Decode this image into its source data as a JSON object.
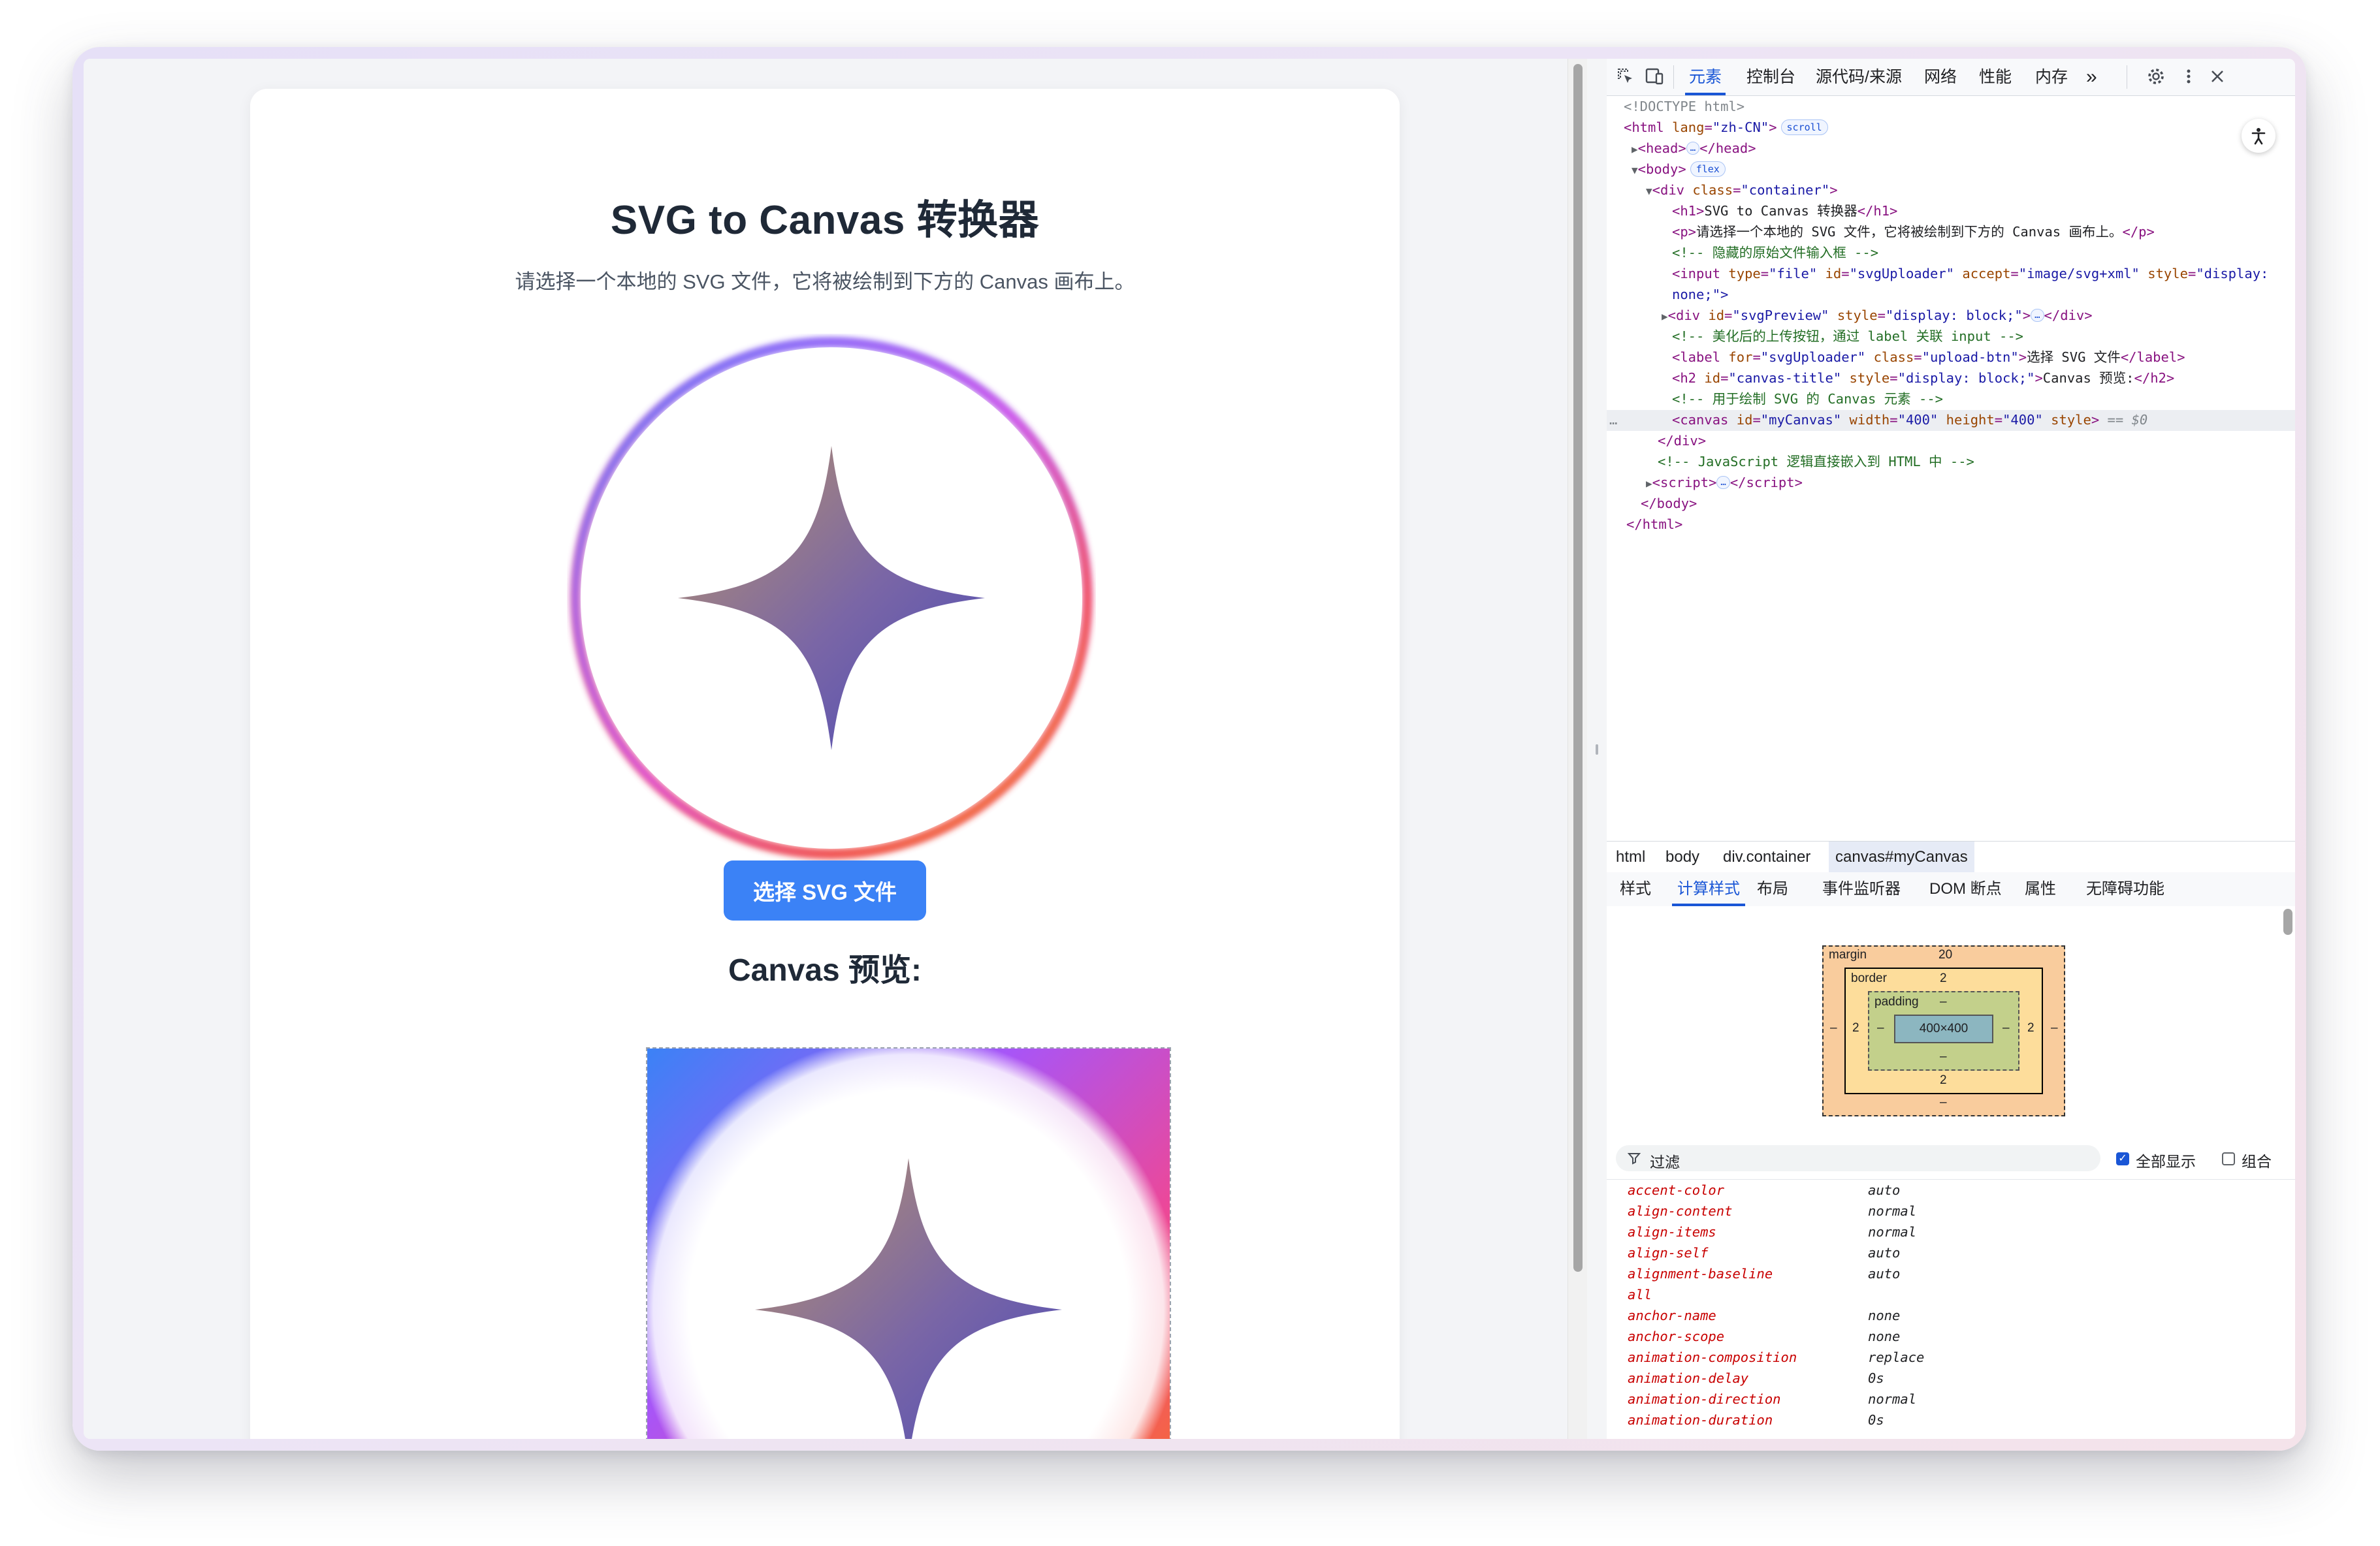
{
  "page": {
    "title": "SVG to Canvas 转换器",
    "description": "请选择一个本地的 SVG 文件，它将被绘制到下方的 Canvas 画布上。",
    "upload_button": "选择 SVG 文件",
    "canvas_heading": "Canvas 预览:"
  },
  "devtools": {
    "tabs": [
      "元素",
      "控制台",
      "源代码/来源",
      "网络",
      "性能",
      "内存"
    ],
    "more_tabs": "»",
    "icons": [
      "inspect-icon",
      "device-toolbar-icon",
      "gear-icon",
      "kebab-menu-icon",
      "close-icon"
    ],
    "dom": {
      "doctype": "<!DOCTYPE html>",
      "html_open_tag": "html",
      "lang_attr": "lang",
      "lang_val": "\"zh-CN\"",
      "scroll_badge": "scroll",
      "head_tag": "head",
      "head_close": "</head>",
      "body_tag": "body",
      "flex_badge": "flex",
      "div_tag": "div",
      "class_attr": "class",
      "container_val": "\"container\"",
      "h1_text": "SVG to Canvas 转换器",
      "p_text": "请选择一个本地的 SVG 文件，它将被绘制到下方的 Canvas 画布上。",
      "comment1": "<!-- 隐藏的原始文件输入框 -->",
      "input_line_1a": "input",
      "type_attr": "type",
      "type_val": "\"file\"",
      "id_attr": "id",
      "uploader_val": "\"svgUploader\"",
      "accept_attr": "accept",
      "accept_val": "\"image/svg+xml\"",
      "style_attr": "style",
      "style_val_start": "\"display:",
      "input_line_2": "none;\">",
      "svgpreview_val": "\"svgPreview\"",
      "display_block": "\"display: block;\"",
      "comment2": "<!-- 美化后的上传按钮，通过 label 关联 input -->",
      "label_for_attr": "for",
      "upload_btn_val": "\"upload-btn\"",
      "label_text": "选择 SVG 文件",
      "canvas_title_val": "\"canvas-title\"",
      "h2_text": "Canvas 预览:",
      "comment3": "<!-- 用于绘制 SVG 的 Canvas 元素 -->",
      "canvas_id_val": "\"myCanvas\"",
      "width_attr": "width",
      "width_val": "\"400\"",
      "height_attr": "height",
      "height_val": "\"400\"",
      "dollar0": "== $0",
      "div_close": "</div>",
      "comment4": "<!-- JavaScript 逻辑直接嵌入到 HTML 中 -->",
      "script_tag": "script",
      "body_close": "</body>",
      "html_close": "</html>",
      "ellipsis": "…",
      "gutter_dots": "…"
    },
    "breadcrumbs": [
      "html",
      "body",
      "div.container",
      "canvas#myCanvas"
    ],
    "subtabs": [
      "样式",
      "计算样式",
      "布局",
      "事件监听器",
      "DOM 断点",
      "属性",
      "无障碍功能"
    ],
    "box_model": {
      "margin_label": "margin",
      "margin_top": "20",
      "margin_bottom": "–",
      "margin_left": "–",
      "margin_right": "–",
      "border_label": "border",
      "border_top": "2",
      "border_bottom": "2",
      "border_left": "2",
      "border_right": "2",
      "padding_label": "padding",
      "padding_top": "–",
      "padding_bottom": "–",
      "padding_left": "–",
      "padding_right": "–",
      "content": "400×400"
    },
    "filter": {
      "placeholder": "过滤",
      "show_all": "全部显示",
      "group": "组合"
    },
    "computed": [
      [
        "accent-color",
        "auto"
      ],
      [
        "align-content",
        "normal"
      ],
      [
        "align-items",
        "normal"
      ],
      [
        "align-self",
        "auto"
      ],
      [
        "alignment-baseline",
        "auto"
      ],
      [
        "all",
        ""
      ],
      [
        "anchor-name",
        "none"
      ],
      [
        "anchor-scope",
        "none"
      ],
      [
        "animation-composition",
        "replace"
      ],
      [
        "animation-delay",
        "0s"
      ],
      [
        "animation-direction",
        "normal"
      ],
      [
        "animation-duration",
        "0s"
      ]
    ]
  }
}
